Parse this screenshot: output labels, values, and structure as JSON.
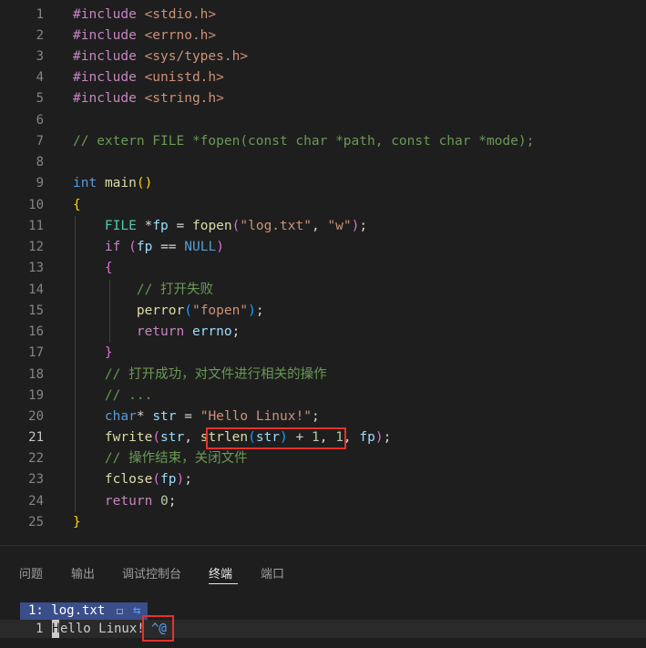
{
  "editor": {
    "active_line": 21,
    "line_numbers": [
      "1",
      "2",
      "3",
      "4",
      "5",
      "6",
      "7",
      "8",
      "9",
      "10",
      "11",
      "12",
      "13",
      "14",
      "15",
      "16",
      "17",
      "18",
      "19",
      "20",
      "21",
      "22",
      "23",
      "24",
      "25"
    ],
    "tokens": {
      "inc": "#include",
      "h_stdio": "<stdio.h>",
      "h_errno": "<errno.h>",
      "h_types": "<sys/types.h>",
      "h_unistd": "<unistd.h>",
      "h_string": "<string.h>",
      "c_extern": "// extern FILE *fopen(const char *path, const char *mode);",
      "kw_int": "int",
      "fn_main": "main",
      "br_open": "(",
      "br_close": ")",
      "cb_open": "{",
      "cb_close": "}",
      "t_file": "FILE",
      "star": "*",
      "v_fp": "fp",
      "eq": "=",
      "fn_fopen": "fopen",
      "s_logtxt": "\"log.txt\"",
      "comma": ",",
      "s_w": "\"w\"",
      "semi": ";",
      "kw_if": "if",
      "eqeq": "==",
      "k_null": "NULL",
      "c_openfail": "// 打开失败",
      "fn_perror": "perror",
      "s_fopen": "\"fopen\"",
      "kw_return": "return",
      "v_errno": "errno",
      "c_opensucc": "// 打开成功，对文件进行相关的操作",
      "c_dots": "// ...",
      "kw_char": "char",
      "v_str": "str",
      "s_hello": "\"Hello Linux!\"",
      "fn_fwrite": "fwrite",
      "fn_strlen": "strlen",
      "plus": "+",
      "n_1": "1",
      "c_opend": "// 操作结束，关闭文件",
      "fn_fclose": "fclose",
      "n_0": "0"
    }
  },
  "panel": {
    "tabs": [
      "问题",
      "输出",
      "调试控制台",
      "终端",
      "端口"
    ],
    "active_tab": "终端"
  },
  "terminal": {
    "status_label": "1: log.txt",
    "status_flag": "☐",
    "status_icon": "⇆",
    "line_number": "1",
    "cursor_char": "H",
    "text": "ello Linux!",
    "ctrl_char": "^@"
  },
  "highlight_color": "#e5322d"
}
